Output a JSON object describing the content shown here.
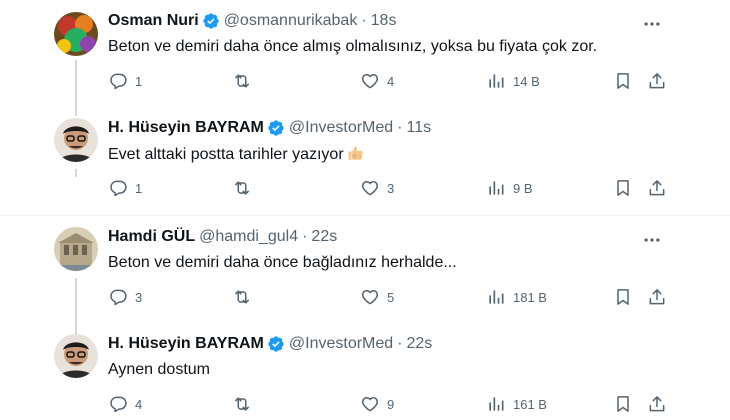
{
  "tweets": [
    {
      "name": "Osman Nuri",
      "verified": true,
      "handle": "@osmannurikabak",
      "time": "18s",
      "text": "Beton ve demiri daha önce almış olmalısınız, yoksa bu fiyata çok zor.",
      "replies": "1",
      "retweets": "",
      "likes": "4",
      "views": "14 B",
      "avatar": "avatar-photo"
    },
    {
      "name": "H. Hüseyin BAYRAM",
      "verified": true,
      "handle": "@InvestorMed",
      "time": "11s",
      "text": "Evet alttaki postta tarihler yazıyor",
      "emoji": "thumbs-up-emoji",
      "replies": "1",
      "retweets": "",
      "likes": "3",
      "views": "9 B",
      "avatar": "avatar-photo"
    },
    {
      "name": "Hamdi GÜL",
      "verified": false,
      "handle": "@hamdi_gul4",
      "time": "22s",
      "text": "Beton ve demiri daha önce bağladınız herhalde...",
      "replies": "3",
      "retweets": "",
      "likes": "5",
      "views": "181 B",
      "avatar": "avatar-photo"
    },
    {
      "name": "H. Hüseyin BAYRAM",
      "verified": true,
      "handle": "@InvestorMed",
      "time": "22s",
      "text": "Aynen dostum",
      "replies": "4",
      "retweets": "",
      "likes": "9",
      "views": "161 B",
      "avatar": "avatar-photo"
    }
  ],
  "separator": "·",
  "colors": {
    "verified": "#1d9bf0",
    "secondary_text": "#536471",
    "primary_text": "#0f1419",
    "thread_line": "#cfd9de"
  },
  "icons": [
    "reply-icon",
    "retweet-icon",
    "like-icon",
    "views-icon",
    "bookmark-icon",
    "share-icon",
    "more-icon",
    "verified-icon"
  ]
}
